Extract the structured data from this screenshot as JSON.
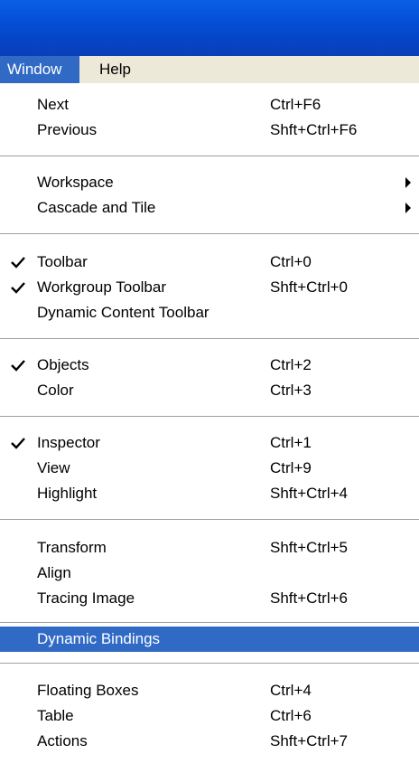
{
  "menubar": {
    "window_label": "Window",
    "help_label": "Help"
  },
  "menu": {
    "items": [
      {
        "label": "Next",
        "shortcut": "Ctrl+F6"
      },
      {
        "label": "Previous",
        "shortcut": "Shft+Ctrl+F6"
      },
      {
        "label": "Workspace",
        "submenu": true
      },
      {
        "label": "Cascade and Tile",
        "submenu": true
      },
      {
        "label": "Toolbar",
        "shortcut": "Ctrl+0",
        "checked": true
      },
      {
        "label": "Workgroup Toolbar",
        "shortcut": "Shft+Ctrl+0",
        "checked": true
      },
      {
        "label": "Dynamic Content Toolbar"
      },
      {
        "label": "Objects",
        "shortcut": "Ctrl+2",
        "checked": true
      },
      {
        "label": "Color",
        "shortcut": "Ctrl+3"
      },
      {
        "label": "Inspector",
        "shortcut": "Ctrl+1",
        "checked": true
      },
      {
        "label": "View",
        "shortcut": "Ctrl+9"
      },
      {
        "label": "Highlight",
        "shortcut": "Shft+Ctrl+4"
      },
      {
        "label": "Transform",
        "shortcut": "Shft+Ctrl+5"
      },
      {
        "label": "Align"
      },
      {
        "label": "Tracing Image",
        "shortcut": "Shft+Ctrl+6"
      },
      {
        "label": "Dynamic Bindings",
        "highlighted": true
      },
      {
        "label": "Floating Boxes",
        "shortcut": "Ctrl+4"
      },
      {
        "label": "Table",
        "shortcut": "Ctrl+6"
      },
      {
        "label": "Actions",
        "shortcut": "Shft+Ctrl+7"
      }
    ]
  },
  "colors": {
    "titlebar": "#0550d8",
    "highlight": "#316ac5",
    "menubar": "#ece9d8"
  }
}
